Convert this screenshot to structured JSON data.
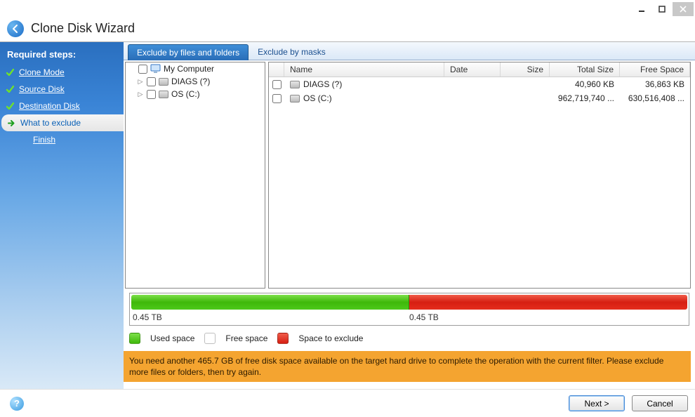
{
  "window": {
    "title": "Clone Disk Wizard"
  },
  "sidebar": {
    "header": "Required steps:",
    "steps": [
      {
        "label": "Clone Mode",
        "state": "done"
      },
      {
        "label": "Source Disk",
        "state": "done"
      },
      {
        "label": "Destination Disk",
        "state": "done"
      },
      {
        "label": "What to exclude",
        "state": "current"
      },
      {
        "label": "Finish",
        "state": "pending"
      }
    ]
  },
  "tabs": {
    "items": [
      {
        "label": "Exclude by files and folders",
        "active": true
      },
      {
        "label": "Exclude by masks",
        "active": false
      }
    ]
  },
  "tree": {
    "root": {
      "label": "My Computer"
    },
    "children": [
      {
        "label": "DIAGS (?)"
      },
      {
        "label": "OS (C:)"
      }
    ]
  },
  "list": {
    "columns": {
      "name": "Name",
      "date": "Date",
      "size": "Size",
      "total": "Total Size",
      "free": "Free Space"
    },
    "rows": [
      {
        "name": "DIAGS (?)",
        "date": "",
        "size": "",
        "total": "40,960 KB",
        "free": "36,863 KB"
      },
      {
        "name": "OS (C:)",
        "date": "",
        "size": "",
        "total": "962,719,740 ...",
        "free": "630,516,408 ..."
      }
    ]
  },
  "capacity": {
    "used_pct": 50,
    "free_pct": 0,
    "exclude_pct": 50,
    "used_label": "0.45 TB",
    "exclude_label": "0.45 TB"
  },
  "legend": {
    "used": "Used space",
    "free": "Free space",
    "exclude": "Space to exclude"
  },
  "warning": "You need another 465.7 GB of free disk space available on the target hard drive to complete the operation with the current filter. Please exclude more files or folders, then try again.",
  "footer": {
    "next": "Next >",
    "cancel": "Cancel"
  }
}
